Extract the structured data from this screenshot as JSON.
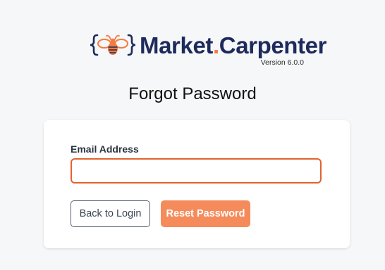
{
  "brand": {
    "name_part1": "Market",
    "name_dot": ".",
    "name_part2": "Carpenter",
    "version": "Version 6.0.0"
  },
  "page": {
    "title": "Forgot Password"
  },
  "form": {
    "email_label": "Email Address",
    "email_value": "",
    "email_placeholder": "",
    "back_label": "Back to Login",
    "reset_label": "Reset Password"
  },
  "colors": {
    "brand_navy": "#1d2a5c",
    "brand_orange": "#f47b3d",
    "input_focus_border": "#e2632d",
    "primary_button": "#f58b5b",
    "page_background": "#f6f7f8"
  },
  "icons": {
    "logo": "bee-in-braces-icon"
  }
}
